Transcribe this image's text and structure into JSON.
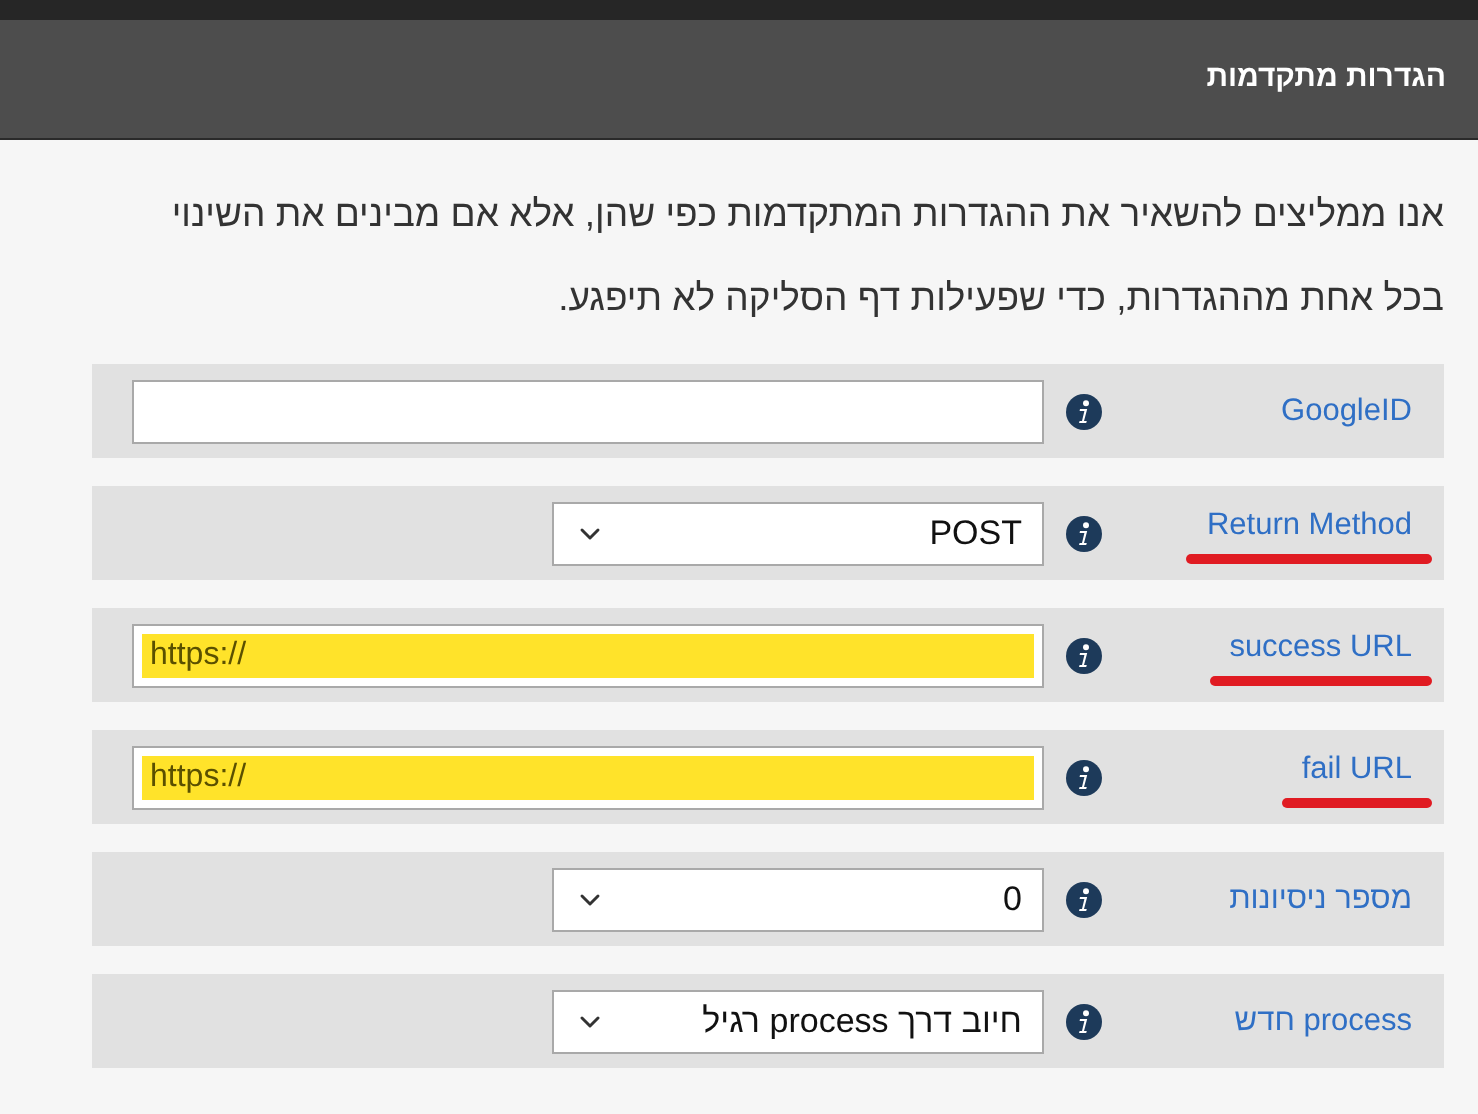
{
  "header": {
    "title": "הגדרות מתקדמות"
  },
  "intro": "אנו ממליצים להשאיר את ההגדרות המתקדמות כפי שהן, אלא אם מבינים את השינוי בכל אחת מההגדרות, כדי שפעילות דף הסליקה לא תיפגע.",
  "settings": [
    {
      "label": "GoogleID",
      "kind": "text",
      "underlined": false,
      "highlighted": false
    },
    {
      "label": "Return Method",
      "kind": "select",
      "value": "POST",
      "underlined": true,
      "highlighted": false
    },
    {
      "label": "success URL",
      "kind": "text",
      "value": "https://",
      "underlined": true,
      "highlighted": true
    },
    {
      "label": "fail URL",
      "kind": "text",
      "value": "https://",
      "underlined": true,
      "highlighted": true
    },
    {
      "label": "מספר ניסיונות",
      "kind": "select",
      "value": "0",
      "underlined": false,
      "highlighted": false
    },
    {
      "label": "process חדש",
      "kind": "select",
      "value": "חיוב דרך process רגיל",
      "underlined": false,
      "highlighted": false
    }
  ]
}
